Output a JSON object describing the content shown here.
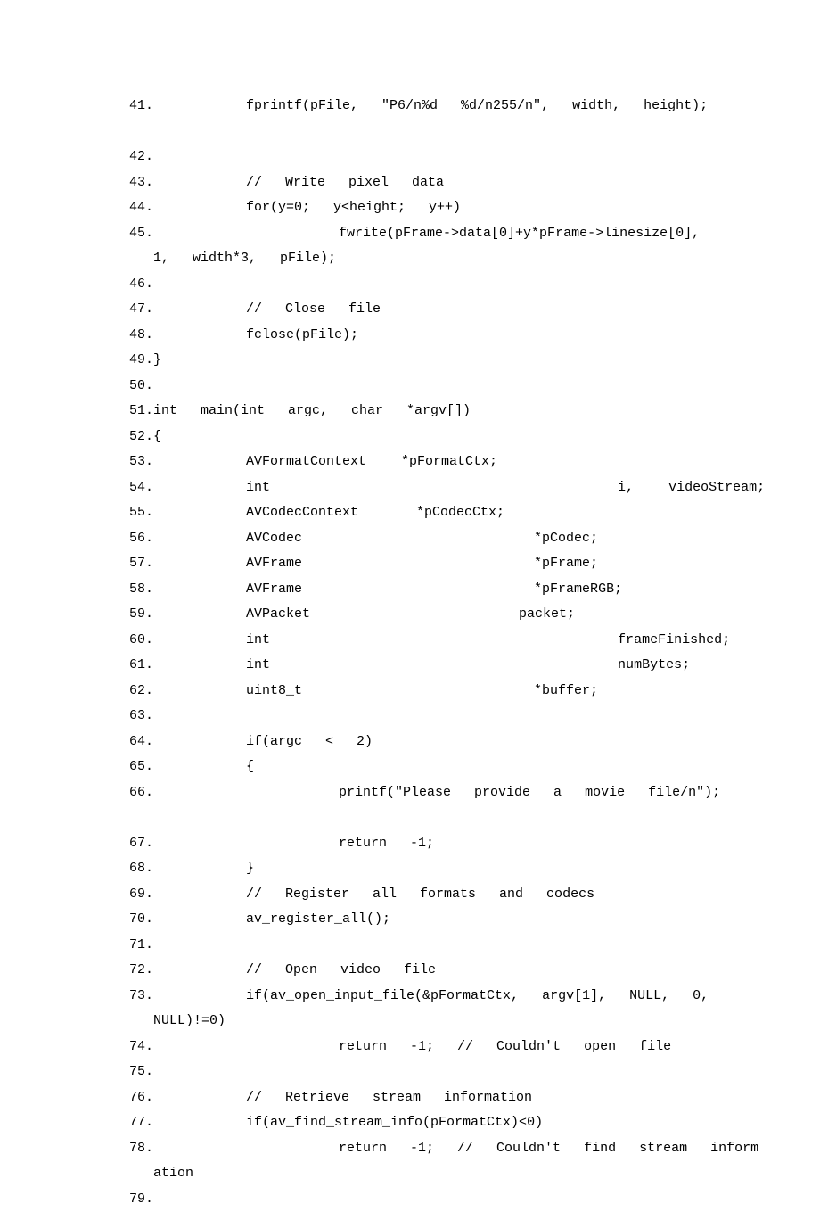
{
  "lines": [
    {
      "n": "41.",
      "text": "        fprintf(pFile,  \"P6/n%d  %d/n255/n\",  width,  height);"
    },
    {
      "n": "",
      "text": "  "
    },
    {
      "n": "42.",
      "text": "  "
    },
    {
      "n": "43.",
      "text": "        //  Write  pixel  data  "
    },
    {
      "n": "44.",
      "text": "        for(y=0;  y<height;  y++)  "
    },
    {
      "n": "45.",
      "text": "                fwrite(pFrame->data[0]+y*pFrame->linesize[0],  "
    },
    {
      "n": "",
      "text": "1,  width*3,  pFile);  "
    },
    {
      "n": "46.",
      "text": "  "
    },
    {
      "n": "47.",
      "text": "        //  Close  file  "
    },
    {
      "n": "48.",
      "text": "        fclose(pFile);  "
    },
    {
      "n": "49.",
      "text": "}  "
    },
    {
      "n": "50.",
      "text": "  "
    },
    {
      "n": "51.",
      "text": "int  main(int  argc,  char  *argv[])  "
    },
    {
      "n": "52.",
      "text": "{  "
    },
    {
      "n": "53.",
      "text": "        AVFormatContext   *pFormatCtx;  "
    },
    {
      "n": "54.",
      "text": "        int                              i,   videoStream;  "
    },
    {
      "n": "55.",
      "text": "        AVCodecContext     *pCodecCtx;  "
    },
    {
      "n": "56.",
      "text": "        AVCodec                    *pCodec;  "
    },
    {
      "n": "57.",
      "text": "        AVFrame                    *pFrame;   "
    },
    {
      "n": "58.",
      "text": "        AVFrame                    *pFrameRGB;  "
    },
    {
      "n": "59.",
      "text": "        AVPacket                  packet;  "
    },
    {
      "n": "60.",
      "text": "        int                              frameFinished;  "
    },
    {
      "n": "61.",
      "text": "        int                              numBytes;  "
    },
    {
      "n": "62.",
      "text": "        uint8_t                    *buffer;  "
    },
    {
      "n": "63.",
      "text": "  "
    },
    {
      "n": "64.",
      "text": "        if(argc  <  2)  "
    },
    {
      "n": "65.",
      "text": "        {  "
    },
    {
      "n": "66.",
      "text": "                printf(\"Please  provide  a  movie  file/n\");"
    },
    {
      "n": "",
      "text": "  "
    },
    {
      "n": "67.",
      "text": "                return  -1;  "
    },
    {
      "n": "68.",
      "text": "        }  "
    },
    {
      "n": "69.",
      "text": "        //  Register  all  formats  and  codecs  "
    },
    {
      "n": "70.",
      "text": "        av_register_all();  "
    },
    {
      "n": "71.",
      "text": "  "
    },
    {
      "n": "72.",
      "text": "        //  Open  video  file  "
    },
    {
      "n": "73.",
      "text": "        if(av_open_input_file(&pFormatCtx,  argv[1],  NULL,  0,  "
    },
    {
      "n": "",
      "text": "NULL)!=0)  "
    },
    {
      "n": "74.",
      "text": "                return  -1;  //  Couldn't  open  file  "
    },
    {
      "n": "75.",
      "text": "  "
    },
    {
      "n": "76.",
      "text": "        //  Retrieve  stream  information  "
    },
    {
      "n": "77.",
      "text": "        if(av_find_stream_info(pFormatCtx)<0)  "
    },
    {
      "n": "78.",
      "text": "                return  -1;  //  Couldn't  find  stream  inform"
    },
    {
      "n": "",
      "text": "ation  "
    },
    {
      "n": "79.",
      "text": "  "
    }
  ]
}
